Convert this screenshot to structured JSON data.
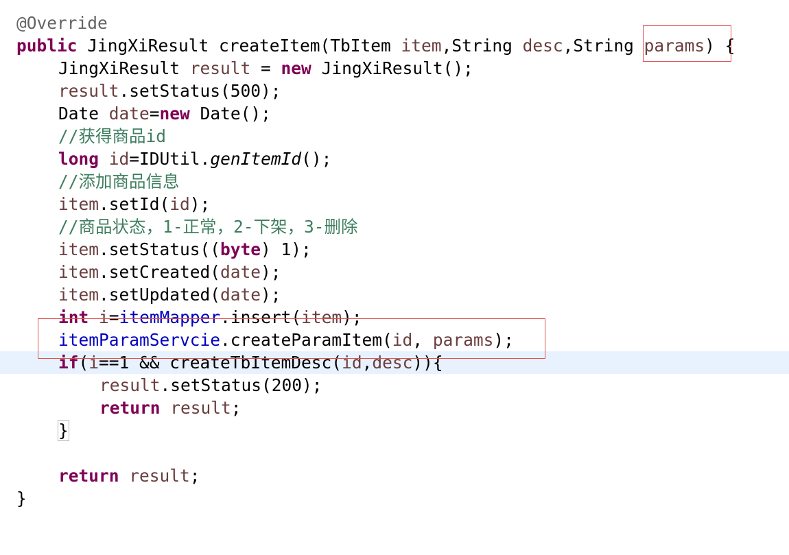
{
  "code": {
    "annotation": "@Override",
    "signature": {
      "kw_public": "public",
      "return_type": " JingXiResult ",
      "method": "createItem(TbItem ",
      "p1": "item",
      "sep1": ",String ",
      "p2": "desc",
      "sep2": ",String ",
      "p3": "params",
      "close": ") {"
    },
    "l3": {
      "type": "JingXiResult ",
      "var": "result",
      "eq": " = ",
      "kw_new": "new",
      "rest": " JingXiResult();"
    },
    "l4": {
      "var": "result",
      "rest": ".setStatus(500);"
    },
    "l5": {
      "type": "Date ",
      "var": "date",
      "eq": "=",
      "kw_new": "new",
      "rest": " Date();"
    },
    "l6": {
      "comment": "//获得商品id"
    },
    "l7": {
      "kw_long": "long",
      "sp": " ",
      "var": "id",
      "eq": "=IDUtil.",
      "method_italic": "genItemId",
      "rest": "();"
    },
    "l8": {
      "comment": "//添加商品信息"
    },
    "l9": {
      "var": "item",
      "mid": ".setId(",
      "arg": "id",
      "rest": ");"
    },
    "l10": {
      "comment": "//商品状态，1-正常，2-下架，3-删除"
    },
    "l11": {
      "var": "item",
      "mid": ".setStatus((",
      "kw_byte": "byte",
      "rest": ") 1);"
    },
    "l12": {
      "var": "item",
      "mid": ".setCreated(",
      "arg": "date",
      "rest": ");"
    },
    "l13": {
      "var": "item",
      "mid": ".setUpdated(",
      "arg": "date",
      "rest": ");"
    },
    "l14": {
      "kw_int": "int",
      "sp": " ",
      "var": "i",
      "eq": "=",
      "field": "itemMapper",
      "mid": ".insert(",
      "arg": "item",
      "rest": ");"
    },
    "l15": {
      "field": "itemParamServcie",
      "mid": ".createParamItem(",
      "arg1": "id",
      "sep": ", ",
      "arg2": "params",
      "rest": ");"
    },
    "l16": {
      "kw_if": "if",
      "open": "(",
      "var": "i",
      "mid": "==1 && createTbItemDesc(",
      "arg1": "id",
      "sep": ",",
      "arg2": "desc",
      "rest": ")){"
    },
    "l17": {
      "var": "result",
      "rest": ".setStatus(200);"
    },
    "l18": {
      "kw_return": "return",
      "sp": " ",
      "var": "result",
      "rest": ";"
    },
    "l19": {
      "brace": "}"
    },
    "l21": {
      "kw_return": "return",
      "sp": " ",
      "var": "result",
      "rest": ";"
    },
    "l22": {
      "brace": "}"
    }
  },
  "colors": {
    "keyword": "#7f0055",
    "local_variable": "#6a3e3e",
    "field": "#0000c0",
    "comment": "#3f7f5f",
    "annotation": "#646464",
    "current_line": "#e8f2fe",
    "highlight_box": "#e05050"
  }
}
